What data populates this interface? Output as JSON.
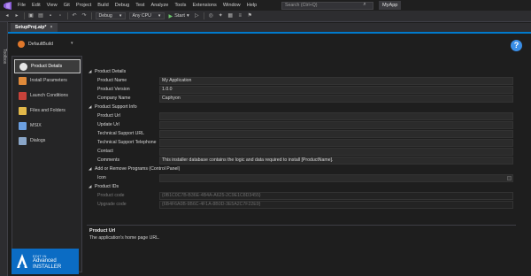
{
  "menu": {
    "items": [
      "File",
      "Edit",
      "View",
      "Git",
      "Project",
      "Build",
      "Debug",
      "Test",
      "Analyze",
      "Tools",
      "Extensions",
      "Window",
      "Help"
    ],
    "search_placeholder": "Search (Ctrl+Q)",
    "app_name": "MyApp"
  },
  "toolbar": {
    "configuration": "Debug",
    "platform": "Any CPU",
    "start_label": "Start"
  },
  "toolbox_label": "Toolbox",
  "document_tab": {
    "title": "SetupProj.aip*",
    "close": "×"
  },
  "build": {
    "name": "DefaultBuild"
  },
  "help_glyph": "?",
  "nav": {
    "items": [
      {
        "label": "Product Details",
        "selected": true,
        "icon_color": "#e7e7e7"
      },
      {
        "label": "Install Parameters",
        "selected": false,
        "icon_color": "#e08a3a"
      },
      {
        "label": "Launch Conditions",
        "selected": false,
        "icon_color": "#c7423a"
      },
      {
        "label": "Files and Folders",
        "selected": false,
        "icon_color": "#e2b84a"
      },
      {
        "label": "MSIX",
        "selected": false,
        "icon_color": "#6b9fe0"
      },
      {
        "label": "Dialogs",
        "selected": false,
        "icon_color": "#8aa6c8"
      }
    ]
  },
  "brand": {
    "line1": "EDIT IN",
    "line2": "Advanced",
    "line3": "INSTALLER",
    "color": "#0b6cc4"
  },
  "grid": {
    "categories": {
      "product_details": "Product Details",
      "support_info": "Product Support Info",
      "add_remove": "Add or Remove Programs (Control Panel)",
      "product_ids": "Product IDs"
    },
    "props": {
      "product_name": {
        "label": "Product Name",
        "value": "My Application"
      },
      "product_version": {
        "label": "Product Version",
        "value": "1.0.0"
      },
      "company_name": {
        "label": "Company Name",
        "value": "Caphyon"
      },
      "product_url": {
        "label": "Product Url",
        "value": ""
      },
      "update_url": {
        "label": "Update Url",
        "value": ""
      },
      "support_url": {
        "label": "Technical Support URL",
        "value": ""
      },
      "support_phone": {
        "label": "Technical Support Telephone",
        "value": ""
      },
      "contact": {
        "label": "Contact",
        "value": ""
      },
      "comments": {
        "label": "Comments",
        "value": "This installer database contains the logic and data required to install [ProductName]."
      },
      "icon": {
        "label": "Icon",
        "value": ""
      },
      "product_code": {
        "label": "Product code",
        "value": "{0B1C0C7B-B36E-4B4A-A625-2C9E1C8D3455}"
      },
      "upgrade_code": {
        "label": "Upgrade code",
        "value": "{6B4F6A0B-9B6C-4F1A-8B0D-3E5A2C7F22E9}"
      }
    }
  },
  "description": {
    "title": "Product Url",
    "text": "The application's home page URL."
  }
}
